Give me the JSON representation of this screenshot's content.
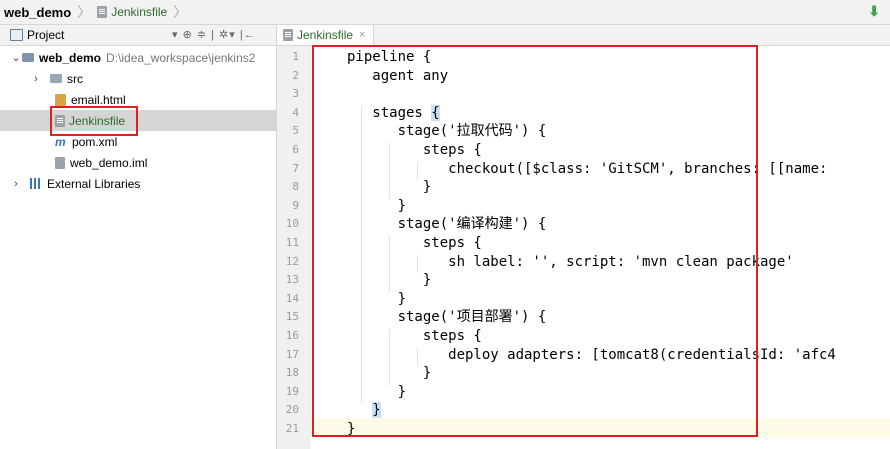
{
  "breadcrumb": {
    "project": "web_demo",
    "file": "Jenkinsfile"
  },
  "project_panel": {
    "title": "Project",
    "tools": "▾ ⊕ ≑ | ✲▾ |←",
    "tree": [
      {
        "label": "web_demo",
        "path": "D:\\idea_workspace\\jenkins2",
        "icon": "folder-icon",
        "expanded": true
      },
      {
        "label": "src",
        "icon": "folder-icon",
        "expanded": false
      },
      {
        "label": "email.html",
        "icon": "html-file-icon"
      },
      {
        "label": "Jenkinsfile",
        "icon": "file-icon",
        "selected": true
      },
      {
        "label": "pom.xml",
        "icon": "maven-icon"
      },
      {
        "label": "web_demo.iml",
        "icon": "module-file-icon"
      },
      {
        "label": "External Libraries",
        "icon": "library-icon",
        "expanded": false
      }
    ]
  },
  "editor": {
    "tab": {
      "label": "Jenkinsfile",
      "close": "×"
    },
    "line_numbers": [
      "1",
      "2",
      "3",
      "4",
      "5",
      "6",
      "7",
      "8",
      "9",
      "10",
      "11",
      "12",
      "13",
      "14",
      "15",
      "16",
      "17",
      "18",
      "19",
      "20",
      "21"
    ],
    "lines": [
      "pipeline {",
      "   agent any",
      "",
      "   stages {",
      "      stage('拉取代码') {",
      "         steps {",
      "            checkout([$class: 'GitSCM', branches: [[name:",
      "         }",
      "      }",
      "      stage('编译构建') {",
      "         steps {",
      "            sh label: '', script: 'mvn clean package'",
      "         }",
      "      }",
      "      stage('项目部署') {",
      "         steps {",
      "            deploy adapters: [tomcat8(credentialsId: 'afc4",
      "         }",
      "      }",
      "   }",
      "}"
    ],
    "highlighted_line": 20
  },
  "colors": {
    "accent_green": "#2d6a2a",
    "annotation_red": "#e02020",
    "selection_gray": "#d5d5d5"
  }
}
